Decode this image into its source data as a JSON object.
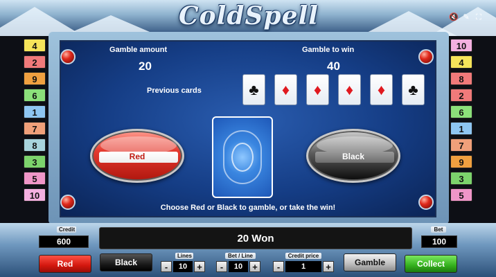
{
  "app": {
    "logo_text": "ColdSpell"
  },
  "top_icons": [
    "sound-icon",
    "settings-icon",
    "fullscreen-icon"
  ],
  "lines_left": [
    {
      "n": "4",
      "color": "#f5e45a"
    },
    {
      "n": "2",
      "color": "#f07a7a"
    },
    {
      "n": "9",
      "color": "#f0a040"
    },
    {
      "n": "6",
      "color": "#8be07a"
    },
    {
      "n": "1",
      "color": "#8ec6f2"
    },
    {
      "n": "7",
      "color": "#f0a07a"
    },
    {
      "n": "8",
      "color": "#a8d4dd"
    },
    {
      "n": "3",
      "color": "#7cd36c"
    },
    {
      "n": "5",
      "color": "#f096c8"
    },
    {
      "n": "10",
      "color": "#f4b0e0"
    }
  ],
  "lines_right": [
    {
      "n": "10",
      "color": "#f4b0e0"
    },
    {
      "n": "4",
      "color": "#f5e45a"
    },
    {
      "n": "8",
      "color": "#f07a7a"
    },
    {
      "n": "2",
      "color": "#f07a7a"
    },
    {
      "n": "6",
      "color": "#8be07a"
    },
    {
      "n": "1",
      "color": "#8ec6f2"
    },
    {
      "n": "7",
      "color": "#f0a07a"
    },
    {
      "n": "9",
      "color": "#f0a040"
    },
    {
      "n": "3",
      "color": "#7cd36c"
    },
    {
      "n": "5",
      "color": "#f096c8"
    }
  ],
  "gamble": {
    "amount_label": "Gamble amount",
    "amount_value": "20",
    "to_win_label": "Gamble to win",
    "to_win_value": "40",
    "previous_label": "Previous cards",
    "previous_cards": [
      {
        "suit": "♣",
        "color": "black"
      },
      {
        "suit": "♦",
        "color": "red"
      },
      {
        "suit": "♦",
        "color": "red"
      },
      {
        "suit": "♦",
        "color": "red"
      },
      {
        "suit": "♦",
        "color": "red"
      },
      {
        "suit": "♣",
        "color": "black"
      }
    ],
    "red_label": "Red",
    "black_label": "Black",
    "instruction": "Choose Red or Black to gamble, or take the win!"
  },
  "footer": {
    "credit_label": "Credit",
    "credit_value": "600",
    "status": "20 Won",
    "bet_label": "Bet",
    "bet_value": "100",
    "red_button": "Red",
    "black_button": "Black",
    "lines_label": "Lines",
    "lines_value": "10",
    "bet_line_label": "Bet / Line",
    "bet_line_value": "10",
    "credit_price_label": "Credit price",
    "credit_price_value": "1",
    "gamble_button": "Gamble",
    "collect_button": "Collect",
    "minus": "-",
    "plus": "+"
  }
}
